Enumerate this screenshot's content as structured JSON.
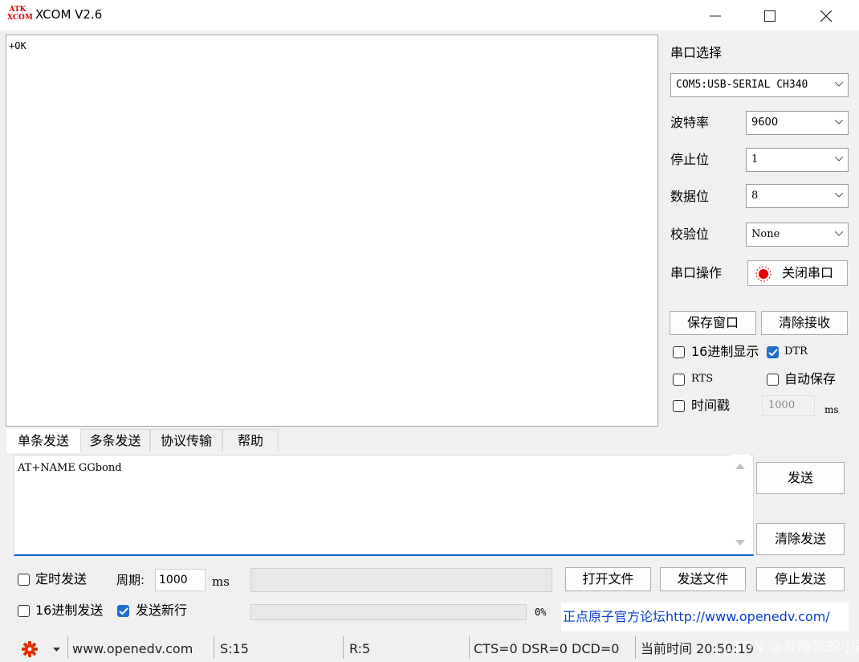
{
  "app": {
    "title": "XCOM V2.6",
    "logo_top": "ATK",
    "logo_bottom": "XCOM"
  },
  "receive": {
    "text": "+OK"
  },
  "serial": {
    "port_label": "串口选择",
    "port_value": "COM5:USB-SERIAL CH340",
    "baud_label": "波特率",
    "baud_value": "9600",
    "stopbits_label": "停止位",
    "stopbits_value": "1",
    "databits_label": "数据位",
    "databits_value": "8",
    "parity_label": "校验位",
    "parity_value": "None",
    "operation_label": "串口操作",
    "operation_button": "关闭串口",
    "status_color": "#e60000"
  },
  "controls": {
    "save_window": "保存窗口",
    "clear_receive": "清除接收",
    "hex_display": {
      "label": "16进制显示",
      "checked": false
    },
    "dtr": {
      "label": "DTR",
      "checked": true
    },
    "rts": {
      "label": "RTS",
      "checked": false
    },
    "auto_save": {
      "label": "自动保存",
      "checked": false
    },
    "timestamp": {
      "label": "时间戳",
      "checked": false
    },
    "timestamp_value": "1000",
    "timestamp_unit": "ms"
  },
  "tabs": [
    "单条发送",
    "多条发送",
    "协议传输",
    "帮助"
  ],
  "active_tab": 0,
  "send": {
    "text": "AT+NAME GGbond",
    "send_button": "发送",
    "clear_button": "清除发送",
    "timed_send": {
      "label": "定时发送",
      "checked": false
    },
    "period_label": "周期:",
    "period_value": "1000",
    "period_unit": "ms",
    "open_file": "打开文件",
    "send_file": "发送文件",
    "stop_send": "停止发送",
    "hex_send": {
      "label": "16进制发送",
      "checked": false
    },
    "send_newline": {
      "label": "发送新行",
      "checked": true
    },
    "progress_percent": "0%",
    "forum_link": "正点原子官方论坛http://www.openedv.com/"
  },
  "statusbar": {
    "website": "www.openedv.com",
    "sent": "S:15",
    "received": "R:5",
    "line_status": "CTS=0 DSR=0 DCD=0",
    "current_time": "当前时间 20:50:19",
    "watermark": "CSDN @爱睡觉的小蒜"
  },
  "colors": {
    "accent": "#1e6fd0",
    "link": "#0a3ccc",
    "gear": "#e03000"
  }
}
